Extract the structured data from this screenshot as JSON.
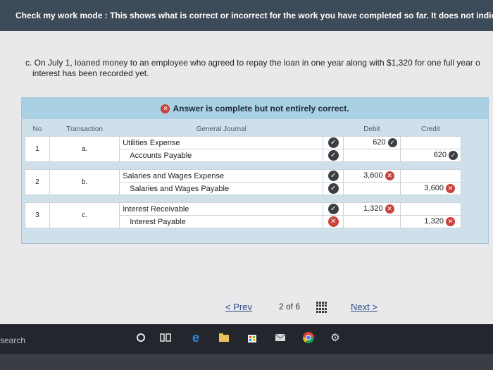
{
  "banner": {
    "text": "Check my work mode : This shows what is correct or incorrect for the work you have completed so far. It does not indica"
  },
  "question": {
    "line1": "c. On July 1, loaned money to an employee who agreed to repay the loan in one year along with $1,320 for one full year o",
    "line2": "interest has been recorded yet."
  },
  "result": {
    "text": "Answer is complete but not entirely correct."
  },
  "table": {
    "headers": {
      "no": "No",
      "transaction": "Transaction",
      "journal": "General Journal",
      "debit": "Debit",
      "credit": "Credit"
    },
    "rows": [
      {
        "no": "1",
        "transaction": "a.",
        "debit_account": "Utilities Expense",
        "credit_account": "Accounts Payable",
        "debit": "620",
        "credit": "620"
      },
      {
        "no": "2",
        "transaction": "b.",
        "debit_account": "Salaries and Wages Expense",
        "credit_account": "Salaries and Wages Payable",
        "debit": "3,600",
        "credit": "3,600"
      },
      {
        "no": "3",
        "transaction": "c.",
        "debit_account": "Interest Receivable",
        "credit_account": "Interest Payable",
        "debit": "1,320",
        "credit": "1,320"
      }
    ]
  },
  "pager": {
    "prev": "Prev",
    "page": "2 of 6",
    "next": "Next"
  },
  "taskbar": {
    "search": "search"
  },
  "colors": {
    "correct": "#3b3f44",
    "incorrect": "#c9413b",
    "banner": "#3d4a58"
  }
}
